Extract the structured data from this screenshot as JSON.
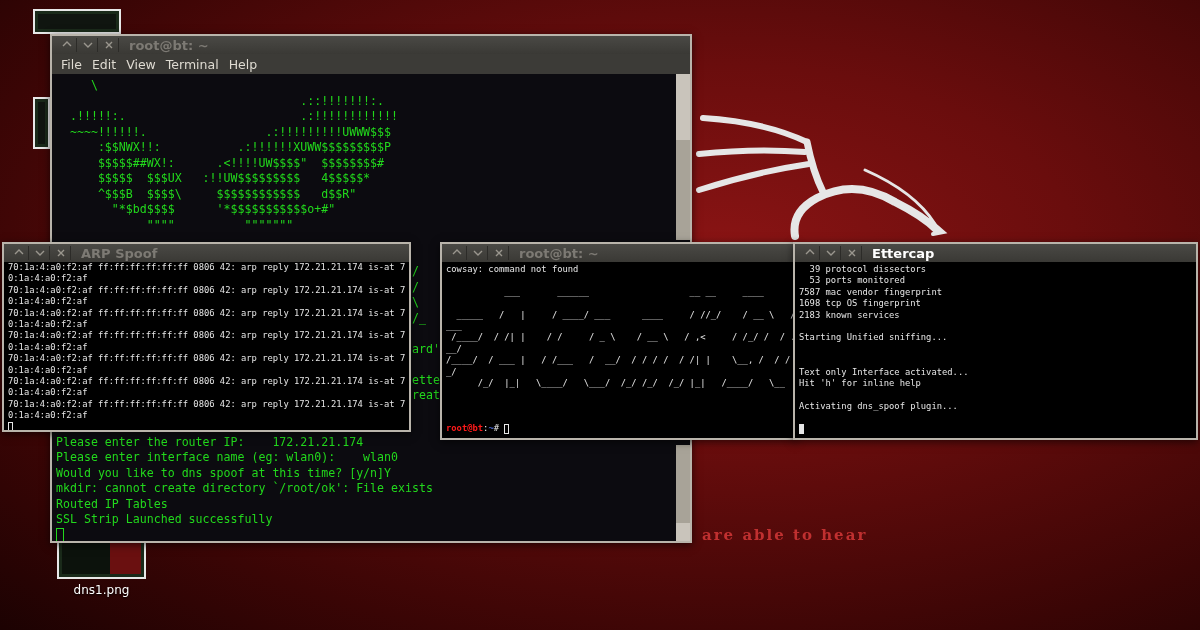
{
  "desktop": {
    "icons": [
      {
        "label": "dns1.png"
      }
    ],
    "wallpaper_text": "are able to hear"
  },
  "windows": [
    {
      "kind": "menu-terminal",
      "title": "root@bt: ~",
      "focused": false,
      "menu": [
        "File",
        "Edit",
        "View",
        "Terminal",
        "Help"
      ],
      "lines": [
        {
          "kind": "text",
          "text": "     \\"
        },
        {
          "kind": "text",
          "text": "                                   .::!!!!!!!:."
        },
        {
          "kind": "text",
          "text": "  .!!!!!:.                         .:!!!!!!!!!!!!"
        },
        {
          "kind": "text",
          "text": "  ~~~~!!!!!!.                 .:!!!!!!!!!UWWW$$$"
        },
        {
          "kind": "text",
          "text": "      :$$NWX!!:           .:!!!!!!XUWW$$$$$$$$$P"
        },
        {
          "kind": "text",
          "text": "      $$$$$##WX!:      .<!!!!UW$$$$\"  $$$$$$$$#"
        },
        {
          "kind": "text",
          "text": "      $$$$$  $$$UX   :!!UW$$$$$$$$$   4$$$$$*"
        },
        {
          "kind": "text",
          "text": "      ^$$$B  $$$$\\     $$$$$$$$$$$$   d$$R\""
        },
        {
          "kind": "text",
          "text": "        \"*$bd$$$$      '*$$$$$$$$$$$o+#\""
        },
        {
          "kind": "text",
          "text": "             \"\"\"\"          \"\"\"\"\"\"\""
        },
        {
          "kind": "blank"
        },
        {
          "kind": "blank"
        },
        {
          "kind": "fragment",
          "text": "/"
        },
        {
          "kind": "fragment",
          "text": "/"
        },
        {
          "kind": "fragment",
          "text": "\\"
        },
        {
          "kind": "fragment",
          "text": "/_"
        },
        {
          "kind": "blank"
        },
        {
          "kind": "fragment",
          "text": "ard'"
        },
        {
          "kind": "blank"
        },
        {
          "kind": "fragment",
          "text": "ette"
        },
        {
          "kind": "fragment",
          "text": "reat"
        },
        {
          "kind": "blank"
        },
        {
          "kind": "blank"
        },
        {
          "kind": "text",
          "text": "Please enter the router IP:    172.21.21.174"
        },
        {
          "kind": "text",
          "text": "Please enter interface name (eg: wlan0):    wlan0"
        },
        {
          "kind": "text",
          "text": "Would you like to dns spoof at this time? [y/n]Y"
        },
        {
          "kind": "text",
          "text": "mkdir: cannot create directory `/root/ok': File exists"
        },
        {
          "kind": "text",
          "text": "Routed IP Tables"
        },
        {
          "kind": "text",
          "text": "SSL Strip Launched successfully"
        }
      ]
    },
    {
      "kind": "terminal",
      "title": "ARP Spoof",
      "focused": false,
      "lines": [
        {
          "kind": "text",
          "text": "70:1a:4:a0:f2:af ff:ff:ff:ff:ff:ff 0806 42: arp reply 172.21.21.174 is-at 7"
        },
        {
          "kind": "text",
          "text": "0:1a:4:a0:f2:af"
        },
        {
          "kind": "text",
          "text": "70:1a:4:a0:f2:af ff:ff:ff:ff:ff:ff 0806 42: arp reply 172.21.21.174 is-at 7"
        },
        {
          "kind": "text",
          "text": "0:1a:4:a0:f2:af"
        },
        {
          "kind": "text",
          "text": "70:1a:4:a0:f2:af ff:ff:ff:ff:ff:ff 0806 42: arp reply 172.21.21.174 is-at 7"
        },
        {
          "kind": "text",
          "text": "0:1a:4:a0:f2:af"
        },
        {
          "kind": "text",
          "text": "70:1a:4:a0:f2:af ff:ff:ff:ff:ff:ff 0806 42: arp reply 172.21.21.174 is-at 7"
        },
        {
          "kind": "text",
          "text": "0:1a:4:a0:f2:af"
        },
        {
          "kind": "text",
          "text": "70:1a:4:a0:f2:af ff:ff:ff:ff:ff:ff 0806 42: arp reply 172.21.21.174 is-at 7"
        },
        {
          "kind": "text",
          "text": "0:1a:4:a0:f2:af"
        },
        {
          "kind": "text",
          "text": "70:1a:4:a0:f2:af ff:ff:ff:ff:ff:ff 0806 42: arp reply 172.21.21.174 is-at 7"
        },
        {
          "kind": "text",
          "text": "0:1a:4:a0:f2:af"
        },
        {
          "kind": "text",
          "text": "70:1a:4:a0:f2:af ff:ff:ff:ff:ff:ff 0806 42: arp reply 172.21.21.174 is-at 7"
        },
        {
          "kind": "text",
          "text": "0:1a:4:a0:f2:af"
        }
      ]
    },
    {
      "kind": "terminal",
      "title": "root@bt: ~",
      "focused": false,
      "lines": [
        {
          "kind": "text",
          "text": "cowsay: command not found"
        },
        {
          "kind": "blank"
        },
        {
          "kind": "text",
          "text": "           ___       ______                   __ __     ____"
        },
        {
          "kind": "blank"
        },
        {
          "kind": "text",
          "text": "  _____   /   |     / ____/ ___      ____     / //_/    / __ \\   /"
        },
        {
          "kind": "text",
          "text": "___"
        },
        {
          "kind": "text",
          "text": " /____/  / /| |    / /     / _ \\    / __ \\   / ,<     / /_/ /  / ."
        },
        {
          "kind": "text",
          "text": "__/"
        },
        {
          "kind": "text",
          "text": "/____/  / ___ |   / /___   /  __/  / / / /  / /| |    \\__, /  / /"
        },
        {
          "kind": "text",
          "text": "_/"
        },
        {
          "kind": "text",
          "text": "      /_/  |_|   \\____/   \\___/  /_/ /_/  /_/ |_|   /____/   \\__"
        },
        {
          "kind": "blank"
        },
        {
          "kind": "blank"
        },
        {
          "kind": "blank"
        },
        {
          "kind": "prompt",
          "user": "root@bt",
          "separator": ":",
          "path": "~",
          "symbol": "#"
        }
      ]
    },
    {
      "kind": "terminal",
      "title": "Ettercap",
      "focused": true,
      "lines": [
        {
          "kind": "text",
          "text": "  39 protocol dissectors"
        },
        {
          "kind": "text",
          "text": "  53 ports monitored"
        },
        {
          "kind": "text",
          "text": "7587 mac vendor fingerprint"
        },
        {
          "kind": "text",
          "text": "1698 tcp OS fingerprint"
        },
        {
          "kind": "text",
          "text": "2183 known services"
        },
        {
          "kind": "blank"
        },
        {
          "kind": "text",
          "text": "Starting Unified sniffing..."
        },
        {
          "kind": "blank"
        },
        {
          "kind": "blank"
        },
        {
          "kind": "text",
          "text": "Text only Interface activated..."
        },
        {
          "kind": "text",
          "text": "Hit 'h' for inline help"
        },
        {
          "kind": "blank"
        },
        {
          "kind": "text",
          "text": "Activating dns_spoof plugin..."
        },
        {
          "kind": "blank"
        }
      ]
    }
  ]
}
